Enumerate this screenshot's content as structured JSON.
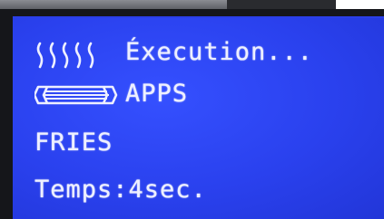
{
  "display": {
    "status_text": "Éxecution...",
    "mode_text": "APPS",
    "food_text": "FRIES",
    "time_text": "Temps:4sec."
  },
  "icons": {
    "status": "heat-waves-icon",
    "mode": "fryer-basket-icon"
  },
  "colors": {
    "lcd_background": "#2a41ee",
    "lcd_text": "#eef0ff",
    "bezel": "#15161a"
  }
}
